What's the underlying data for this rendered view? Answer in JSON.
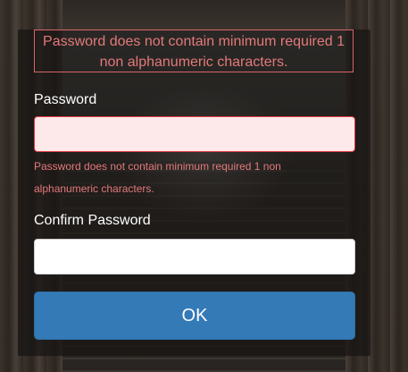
{
  "form": {
    "validation_summary": "Password does not contain minimum required 1 non alphanumeric characters.",
    "password": {
      "label": "Password",
      "value": "",
      "error": "Password does not contain minimum required 1 non alphanumeric characters."
    },
    "confirm_password": {
      "label": "Confirm Password",
      "value": ""
    },
    "submit_label": "OK"
  },
  "colors": {
    "error_text": "#e3797b",
    "error_border": "#e23a43",
    "error_field_bg": "#fde9ea",
    "button_primary": "#337ab7"
  }
}
